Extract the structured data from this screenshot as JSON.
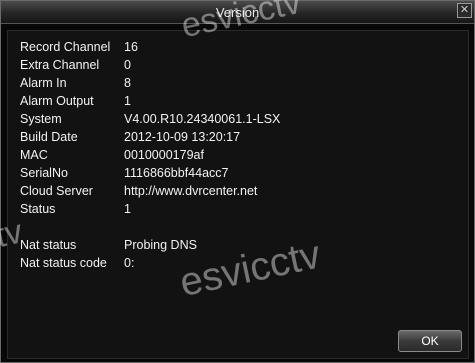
{
  "window": {
    "title": "Version",
    "close_glyph": "✕",
    "ok_label": "OK"
  },
  "info": [
    {
      "label": "Record Channel",
      "value": "16"
    },
    {
      "label": "Extra Channel",
      "value": "0"
    },
    {
      "label": "Alarm In",
      "value": "8"
    },
    {
      "label": "Alarm Output",
      "value": "1"
    },
    {
      "label": "System",
      "value": "V4.00.R10.24340061.1-LSX"
    },
    {
      "label": "Build Date",
      "value": "2012-10-09 13:20:17"
    },
    {
      "label": "MAC",
      "value": "0010000179af"
    },
    {
      "label": "SerialNo",
      "value": "1116866bbf44acc7"
    },
    {
      "label": "Cloud Server",
      "value": "http://www.dvrcenter.net"
    },
    {
      "label": "Status",
      "value": "1"
    }
  ],
  "nat": [
    {
      "label": "Nat status",
      "value": "Probing DNS"
    },
    {
      "label": "Nat status code",
      "value": "0:"
    }
  ],
  "watermarks": [
    "esvicctv",
    "esvicctv",
    "tv"
  ]
}
